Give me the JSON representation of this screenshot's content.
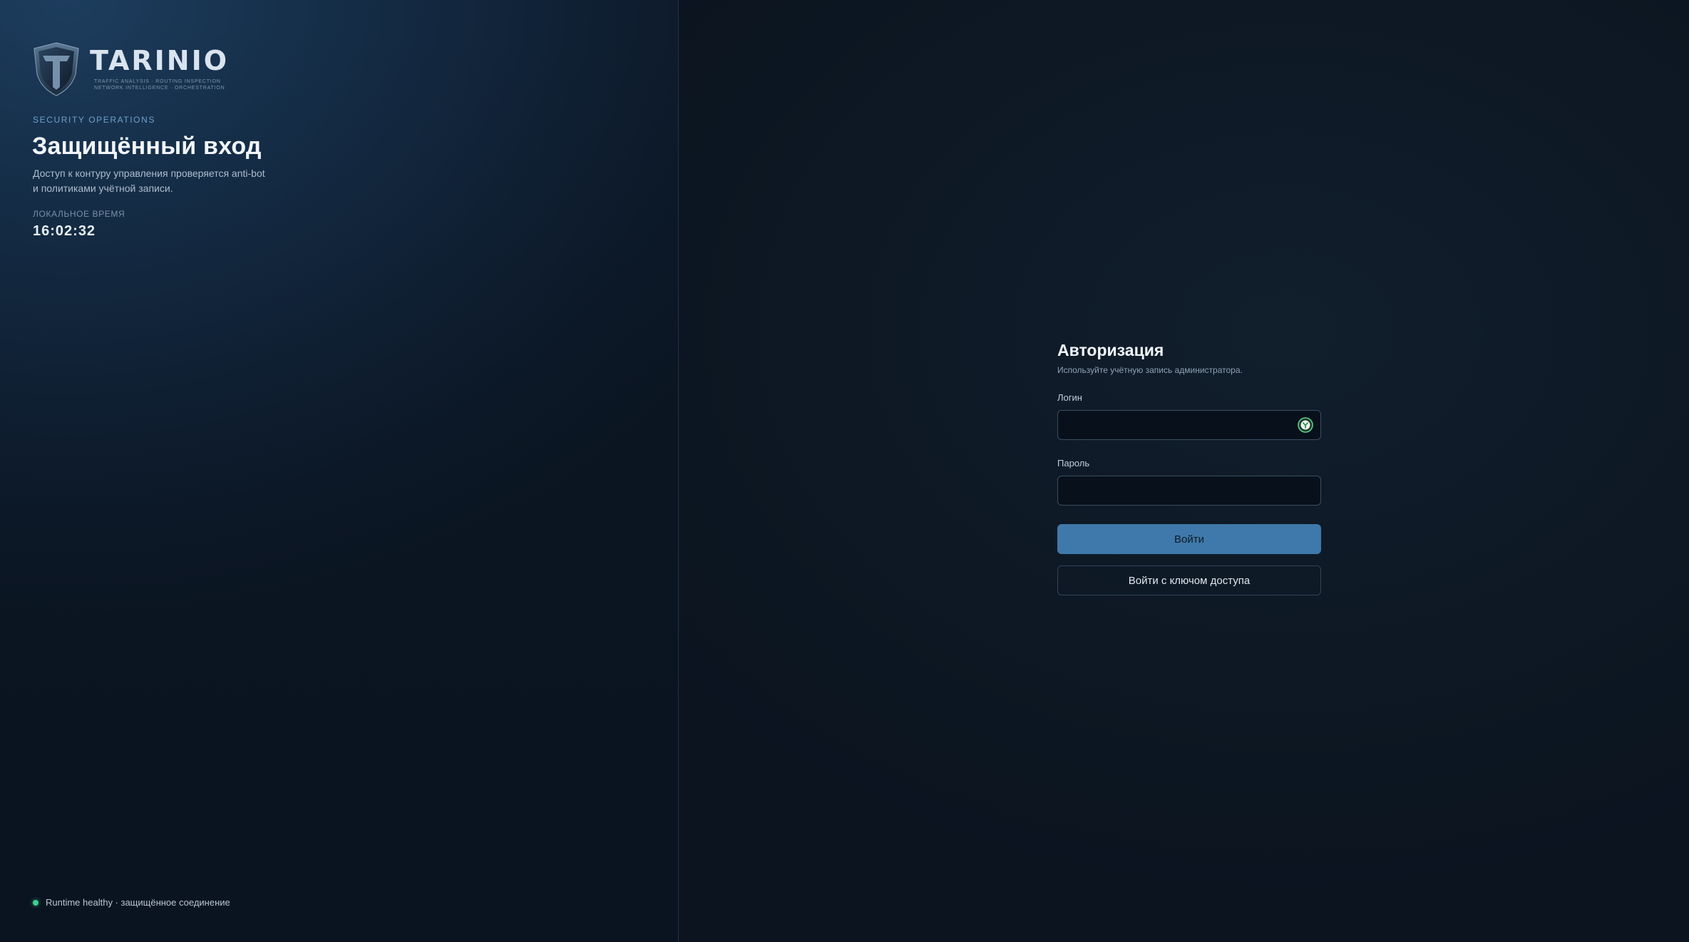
{
  "brand": {
    "name": "TARINIO",
    "tagline_line1": "TRAFFIC ANALYSIS · ROUTING INSPECTION",
    "tagline_line2": "NETWORK INTELLIGENCE · ORCHESTRATION",
    "logo_icon": "shield-icon"
  },
  "hero": {
    "kicker": "SECURITY OPERATIONS",
    "title": "Защищённый вход",
    "description_line1": "Доступ к контуру управления проверяется anti-bot",
    "description_line2": "и политиками учётной записи.",
    "time_label": "ЛОКАЛЬНОЕ ВРЕМЯ",
    "time_value": "16:02:32"
  },
  "status": {
    "text": "Runtime healthy · защищённое соединение",
    "color": "#3ccf8e"
  },
  "form": {
    "title": "Авторизация",
    "subtitle": "Используйте учётную запись администратора.",
    "login_label": "Логин",
    "login_value": "",
    "login_icon": "password-manager-icon",
    "password_label": "Пароль",
    "password_value": "",
    "submit_label": "Войти",
    "passkey_label": "Войти с ключом доступа"
  },
  "colors": {
    "accent": "#3f79ab",
    "kicker": "#6ea0cf",
    "background": "#0c1622"
  }
}
